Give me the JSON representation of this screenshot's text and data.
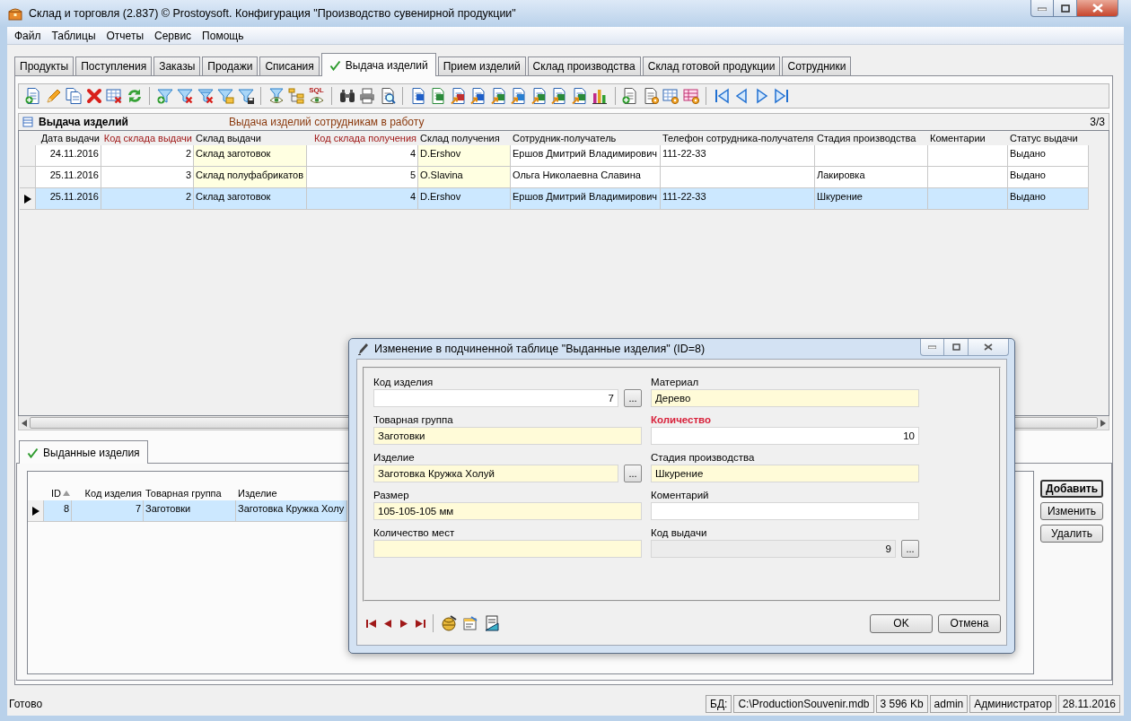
{
  "window": {
    "title": "Склад и торговля (2.837) © Prostoysoft. Конфигурация \"Производство сувенирной продукции\""
  },
  "menu": [
    "Файл",
    "Таблицы",
    "Отчеты",
    "Сервис",
    "Помощь"
  ],
  "tabs": [
    {
      "label": "Продукты",
      "selected": false
    },
    {
      "label": "Поступления",
      "selected": false
    },
    {
      "label": "Заказы",
      "selected": false
    },
    {
      "label": "Продажи",
      "selected": false
    },
    {
      "label": "Списания",
      "selected": false
    },
    {
      "label": "Выдача изделий",
      "selected": true
    },
    {
      "label": "Прием изделий",
      "selected": false
    },
    {
      "label": "Склад производства",
      "selected": false
    },
    {
      "label": "Склад готовой продукции",
      "selected": false
    },
    {
      "label": "Сотрудники",
      "selected": false
    }
  ],
  "toolbar": {
    "sql_label": "SQL"
  },
  "main_table": {
    "title": "Выдача изделий",
    "description": "Выдача изделий сотрудникам в работу",
    "count": "3/3",
    "columns": [
      {
        "label": "Дата выдачи",
        "kind": "date"
      },
      {
        "label": "Код склада выдачи",
        "kind": "code"
      },
      {
        "label": "Склад выдачи",
        "kind": "lookup"
      },
      {
        "label": "Код склада получения",
        "kind": "code"
      },
      {
        "label": "Склад получения",
        "kind": "lookup"
      },
      {
        "label": "Сотрудник-получатель",
        "kind": "text"
      },
      {
        "label": "Телефон сотрудника-получателя",
        "kind": "text"
      },
      {
        "label": "Стадия производства",
        "kind": "text"
      },
      {
        "label": "Коментарии",
        "kind": "text"
      },
      {
        "label": "Статус выдачи",
        "kind": "text"
      }
    ],
    "rows": [
      {
        "selected": false,
        "cells": [
          "24.11.2016",
          "2",
          "Склад заготовок",
          "4",
          "D.Ershov",
          "Ершов Дмитрий Владимирович",
          "111-22-33",
          null,
          null,
          "Выдано"
        ]
      },
      {
        "selected": false,
        "cells": [
          "25.11.2016",
          "3",
          "Склад полуфабрикатов",
          "5",
          "O.Slavina",
          "Ольга Николаевна Славина",
          null,
          "Лакировка",
          null,
          "Выдано"
        ]
      },
      {
        "selected": true,
        "cells": [
          "25.11.2016",
          "2",
          "Склад заготовок",
          "4",
          "D.Ershov",
          "Ершов Дмитрий Владимирович",
          "111-22-33",
          "Шкурение",
          null,
          "Выдано"
        ]
      }
    ]
  },
  "detail_tabs": [
    {
      "label": "Выданные изделия",
      "selected": true
    }
  ],
  "detail_table": {
    "columns": [
      {
        "label": "ID",
        "kind": "number",
        "sorted": true
      },
      {
        "label": "Код изделия",
        "kind": "number",
        "sorted": false
      },
      {
        "label": "Товарная группа",
        "kind": "text",
        "sorted": false
      },
      {
        "label": "Изделие",
        "kind": "text",
        "sorted": false
      }
    ],
    "rows": [
      {
        "selected": true,
        "cells": [
          "8",
          "7",
          "Заготовки",
          "Заготовка Кружка Холу"
        ]
      }
    ]
  },
  "detail_buttons": [
    {
      "label": "Добавить",
      "default": true
    },
    {
      "label": "Изменить",
      "default": false
    },
    {
      "label": "Удалить",
      "default": false
    }
  ],
  "dialog": {
    "title": "Изменение в подчиненной таблице \"Выданные изделия\" (ID=8)",
    "fields": [
      {
        "label": "Код изделия",
        "value": "7",
        "kind": "number",
        "required": false,
        "browse": "..."
      },
      {
        "label": "Материал",
        "value": "Дерево",
        "kind": "lookup",
        "required": false
      },
      {
        "label": "Товарная группа",
        "value": "Заготовки",
        "kind": "lookup",
        "required": false
      },
      {
        "label": "Количество",
        "value": "10",
        "kind": "number",
        "required": true
      },
      {
        "label": "Изделие",
        "value": "Заготовка Кружка Холуй",
        "kind": "lookup",
        "required": false,
        "browse": "..."
      },
      {
        "label": "Стадия производства",
        "value": "Шкурение",
        "kind": "lookup",
        "required": false
      },
      {
        "label": "Размер",
        "value": "105-105-105 мм",
        "kind": "lookup",
        "required": false
      },
      {
        "label": "Коментарий",
        "kind": "text",
        "required": false
      },
      {
        "label": "Количество мест",
        "kind": "lookup",
        "required": false
      },
      {
        "label": "Код выдачи",
        "value": "9",
        "kind": "readonly_number",
        "required": false,
        "browse": "..."
      }
    ],
    "buttons": [
      "OK",
      "Отмена"
    ]
  },
  "status_bar": {
    "status": "Готово",
    "panels": [
      "БД:",
      "C:\\ProductionSouvenir.mdb",
      "3 596 Kb",
      "admin",
      "Администратор",
      "28.11.2016"
    ]
  }
}
